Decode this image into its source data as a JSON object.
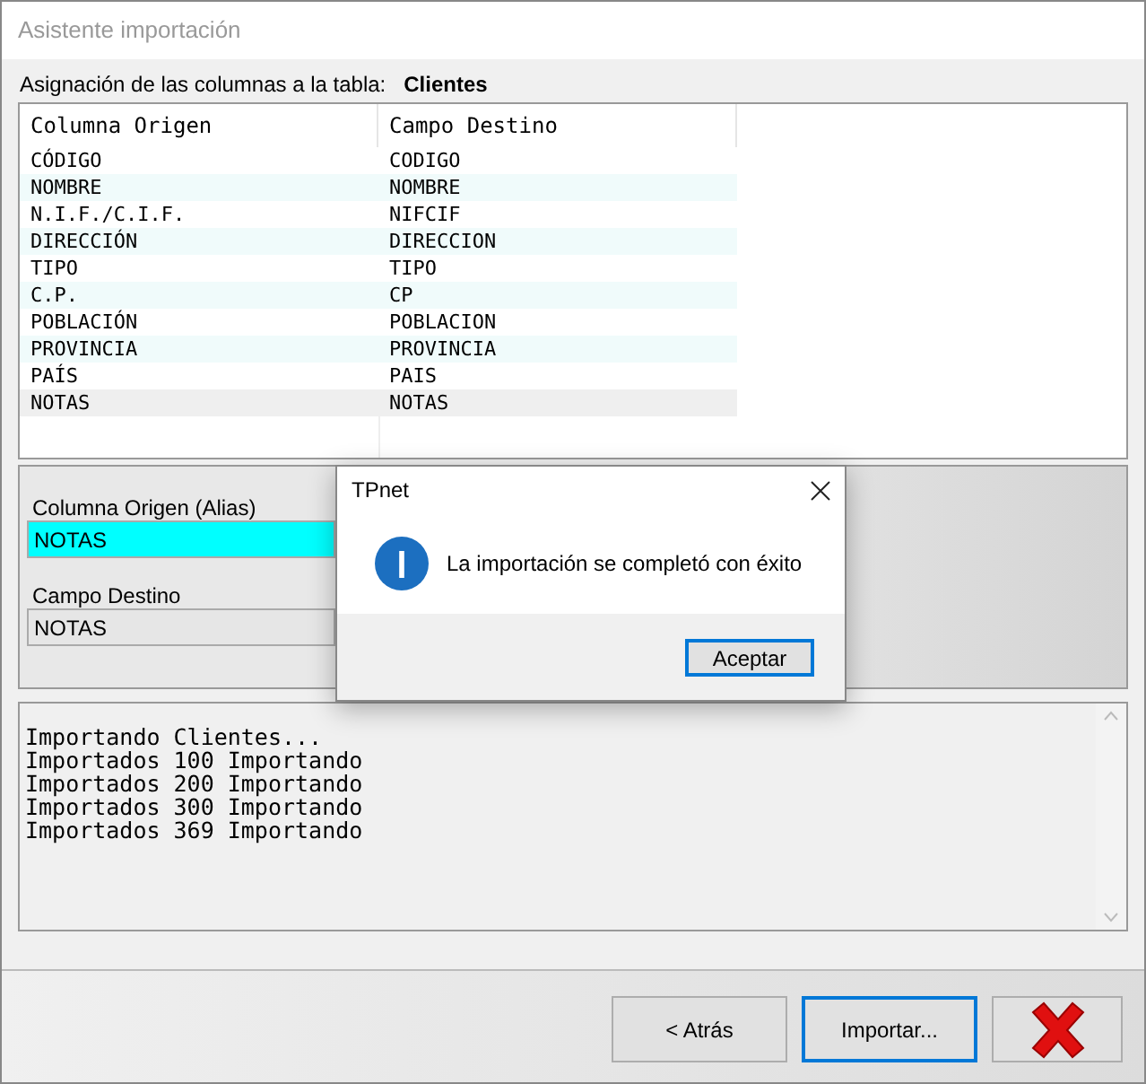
{
  "window": {
    "title": "Asistente importación"
  },
  "mapping": {
    "label": "Asignación de las columnas a la tabla:",
    "table_name": "Clientes"
  },
  "table": {
    "columns": [
      "Columna Origen",
      "Campo Destino"
    ],
    "rows": [
      {
        "cells": [
          "CÓDIGO",
          "CODIGO"
        ],
        "selected": false
      },
      {
        "cells": [
          "NOMBRE",
          "NOMBRE"
        ],
        "selected": false
      },
      {
        "cells": [
          "N.I.F./C.I.F.",
          "NIFCIF"
        ],
        "selected": false
      },
      {
        "cells": [
          "DIRECCIÓN",
          "DIRECCION"
        ],
        "selected": false
      },
      {
        "cells": [
          "TIPO",
          "TIPO"
        ],
        "selected": false
      },
      {
        "cells": [
          "C.P.",
          "CP"
        ],
        "selected": false
      },
      {
        "cells": [
          "POBLACIÓN",
          "POBLACION"
        ],
        "selected": false
      },
      {
        "cells": [
          "PROVINCIA",
          "PROVINCIA"
        ],
        "selected": false
      },
      {
        "cells": [
          "PAÍS",
          "PAIS"
        ],
        "selected": false
      },
      {
        "cells": [
          "NOTAS",
          "NOTAS"
        ],
        "selected": true
      }
    ]
  },
  "fields": [
    {
      "label": "Columna Origen (Alias)",
      "value": "NOTAS",
      "kind": "highlighted"
    },
    {
      "label": "Campo Destino",
      "value": "NOTAS",
      "kind": "plain"
    }
  ],
  "log": [
    "Importando Clientes...",
    "Importados 100 Importando",
    "Importados 200 Importando",
    "Importados 300 Importando",
    "Importados 369 Importando"
  ],
  "buttons": [
    {
      "label": "< Atrás",
      "kind": "text",
      "default": false
    },
    {
      "label": "Importar...",
      "kind": "text",
      "default": true
    },
    {
      "kind": "cancel",
      "default": false
    }
  ],
  "dialog": {
    "title": "TPnet",
    "message": "La importación se completó con éxito",
    "button": "Aceptar"
  }
}
